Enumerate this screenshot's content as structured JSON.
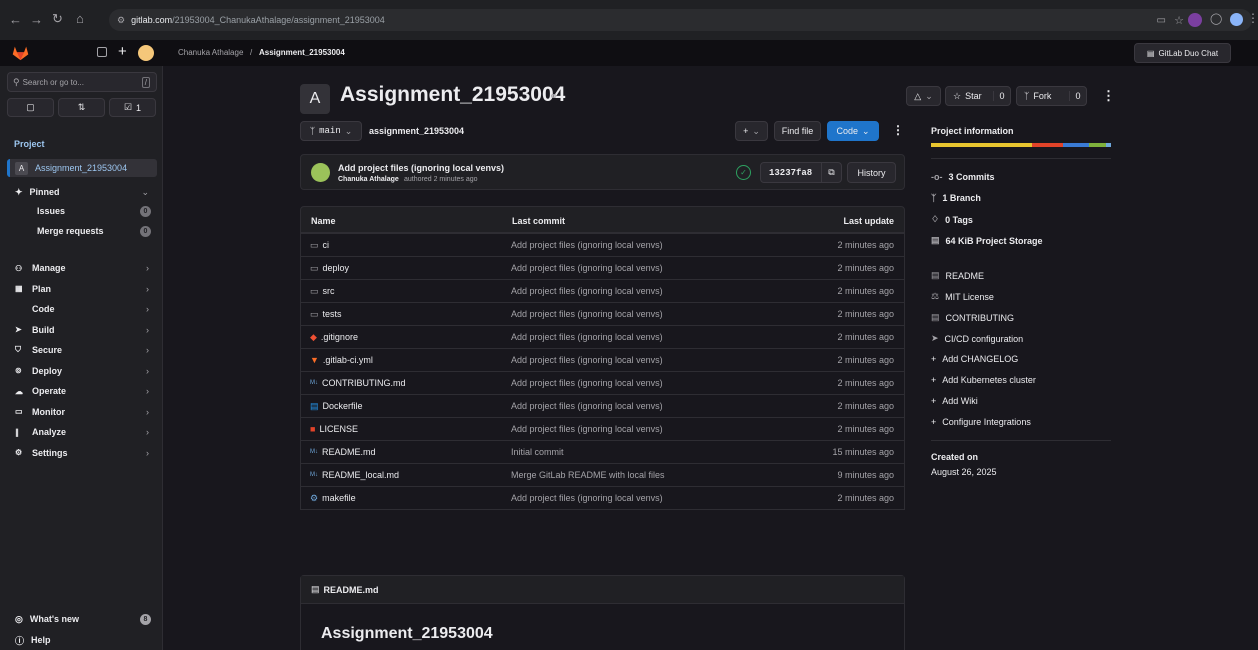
{
  "browser": {
    "url_host": "gitlab.com",
    "url_path": "/21953004_ChanukaAthalage/assignment_21953004"
  },
  "top": {
    "breadcrumb_user": "Chanuka Athalage",
    "breadcrumb_sep": "/",
    "breadcrumb_project": "Assignment_21953004",
    "duo_label": "GitLab Duo Chat"
  },
  "sidebar": {
    "search_placeholder": "Search or go to...",
    "todo_count": "1",
    "section": "Project",
    "project_avatar": "A",
    "project_name": "Assignment_21953004",
    "pinned_label": "Pinned",
    "issues_label": "Issues",
    "issues_count": "0",
    "mr_label": "Merge requests",
    "mr_count": "0",
    "items": [
      {
        "label": "Manage",
        "icon": "users-icon"
      },
      {
        "label": "Plan",
        "icon": "calendar-icon"
      },
      {
        "label": "Code",
        "icon": "code-icon"
      },
      {
        "label": "Build",
        "icon": "rocket-icon"
      },
      {
        "label": "Secure",
        "icon": "shield-icon"
      },
      {
        "label": "Deploy",
        "icon": "deploy-icon"
      },
      {
        "label": "Operate",
        "icon": "cloud-icon"
      },
      {
        "label": "Monitor",
        "icon": "monitor-icon"
      },
      {
        "label": "Analyze",
        "icon": "chart-icon"
      },
      {
        "label": "Settings",
        "icon": "settings-icon"
      }
    ],
    "whats_new": "What's new",
    "whats_new_count": "8",
    "help": "Help"
  },
  "project": {
    "avatar": "A",
    "title": "Assignment_21953004",
    "notify_label": "",
    "star_label": "Star",
    "star_count": "0",
    "fork_label": "Fork",
    "fork_count": "0",
    "branch": "main",
    "path": "assignment_21953004",
    "find_file": "Find file",
    "code_label": "Code"
  },
  "commit": {
    "message": "Add project files (ignoring local venvs)",
    "author": "Chanuka Athalage",
    "authored": "authored 2 minutes ago",
    "sha": "13237fa8",
    "history": "History"
  },
  "table": {
    "headers": {
      "name": "Name",
      "last_commit": "Last commit",
      "last_update": "Last update"
    },
    "rows": [
      {
        "name": "ci",
        "type": "folder",
        "commit": "Add project files (ignoring local venvs)",
        "time": "2 minutes ago"
      },
      {
        "name": "deploy",
        "type": "folder",
        "commit": "Add project files (ignoring local venvs)",
        "time": "2 minutes ago"
      },
      {
        "name": "src",
        "type": "folder",
        "commit": "Add project files (ignoring local venvs)",
        "time": "2 minutes ago"
      },
      {
        "name": "tests",
        "type": "folder",
        "commit": "Add project files (ignoring local venvs)",
        "time": "2 minutes ago"
      },
      {
        "name": ".gitignore",
        "type": "git",
        "commit": "Add project files (ignoring local venvs)",
        "time": "2 minutes ago"
      },
      {
        "name": ".gitlab-ci.yml",
        "type": "gitlab",
        "commit": "Add project files (ignoring local venvs)",
        "time": "2 minutes ago"
      },
      {
        "name": "CONTRIBUTING.md",
        "type": "md",
        "commit": "Add project files (ignoring local venvs)",
        "time": "2 minutes ago"
      },
      {
        "name": "Dockerfile",
        "type": "docker",
        "commit": "Add project files (ignoring local venvs)",
        "time": "2 minutes ago"
      },
      {
        "name": "LICENSE",
        "type": "license",
        "commit": "Add project files (ignoring local venvs)",
        "time": "2 minutes ago"
      },
      {
        "name": "README.md",
        "type": "md",
        "commit": "Initial commit",
        "time": "15 minutes ago"
      },
      {
        "name": "README_local.md",
        "type": "md",
        "commit": "Merge GitLab README with local files",
        "time": "9 minutes ago"
      },
      {
        "name": "makefile",
        "type": "make",
        "commit": "Add project files (ignoring local venvs)",
        "time": "2 minutes ago"
      }
    ]
  },
  "readme": {
    "file": "README.md",
    "heading": "Assignment_21953004"
  },
  "info": {
    "title": "Project information",
    "commits": "3 Commits",
    "branch": "1 Branch",
    "tags": "0 Tags",
    "storage": "64 KiB Project Storage",
    "readme": "README",
    "license": "MIT License",
    "contributing": "CONTRIBUTING",
    "cicd": "CI/CD configuration",
    "add_changelog": "Add CHANGELOG",
    "add_k8s": "Add Kubernetes cluster",
    "add_wiki": "Add Wiki",
    "configure": "Configure Integrations",
    "created_label": "Created on",
    "created_date": "August 26, 2025"
  },
  "colors": {
    "accent": "#1f75cb",
    "brand": "#fc6d26",
    "success": "#2da160"
  }
}
